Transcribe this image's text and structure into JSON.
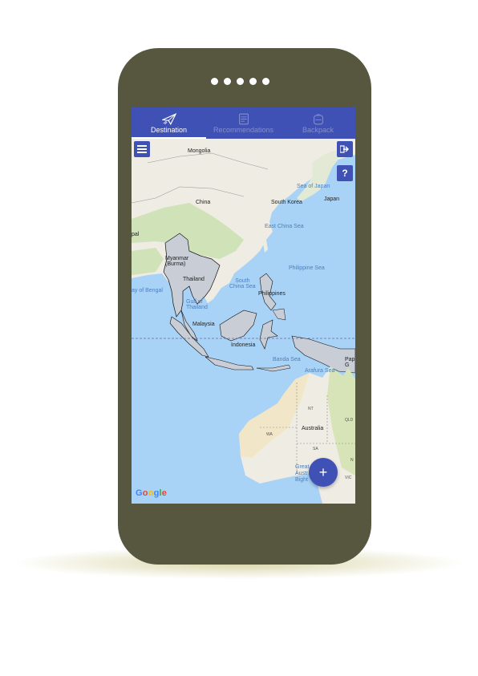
{
  "tabs": [
    {
      "label": "Destination",
      "active": true,
      "icon": "paper-plane-icon"
    },
    {
      "label": "Recommendations",
      "active": false,
      "icon": "clipboard-icon"
    },
    {
      "label": "Backpack",
      "active": false,
      "icon": "backpack-icon"
    }
  ],
  "map": {
    "labels": {
      "mongolia": "Mongolia",
      "china": "China",
      "south_korea": "South Korea",
      "japan": "Japan",
      "myanmar": "Myanmar\n(Burma)",
      "thailand": "Thailand",
      "malaysia": "Malaysia",
      "philippines": "Philippines",
      "indonesia": "Indonesia",
      "australia": "Australia",
      "nt": "NT",
      "wa": "WA",
      "sa": "SA",
      "qld": "QLD",
      "vic": "VIC",
      "n": "N",
      "pap": "Pap\nG",
      "pal": "pal",
      "sea_of_japan": "Sea of Japan",
      "east_china_sea": "East China Sea",
      "philippine_sea": "Philippine Sea",
      "south_china_sea": "South\nChina Sea",
      "bay_of_bengal": "ay of Bengal",
      "gulf_of_thailand": "Gulf of\nThailand",
      "banda_sea": "Banda Sea",
      "arafura_sea": "Arafura Sea",
      "great_australian_bight": "Great\nAustral\nBight"
    },
    "google_logo": "Google"
  },
  "buttons": {
    "menu_icon": "menu-icon",
    "logout_icon": "logout-icon",
    "help_label": "?",
    "fab_label": "+"
  },
  "colors": {
    "primary": "#3f51b5",
    "phone_body": "#57563f",
    "ocean": "#a9d3f6",
    "selected_region": "#c8cdd6"
  }
}
